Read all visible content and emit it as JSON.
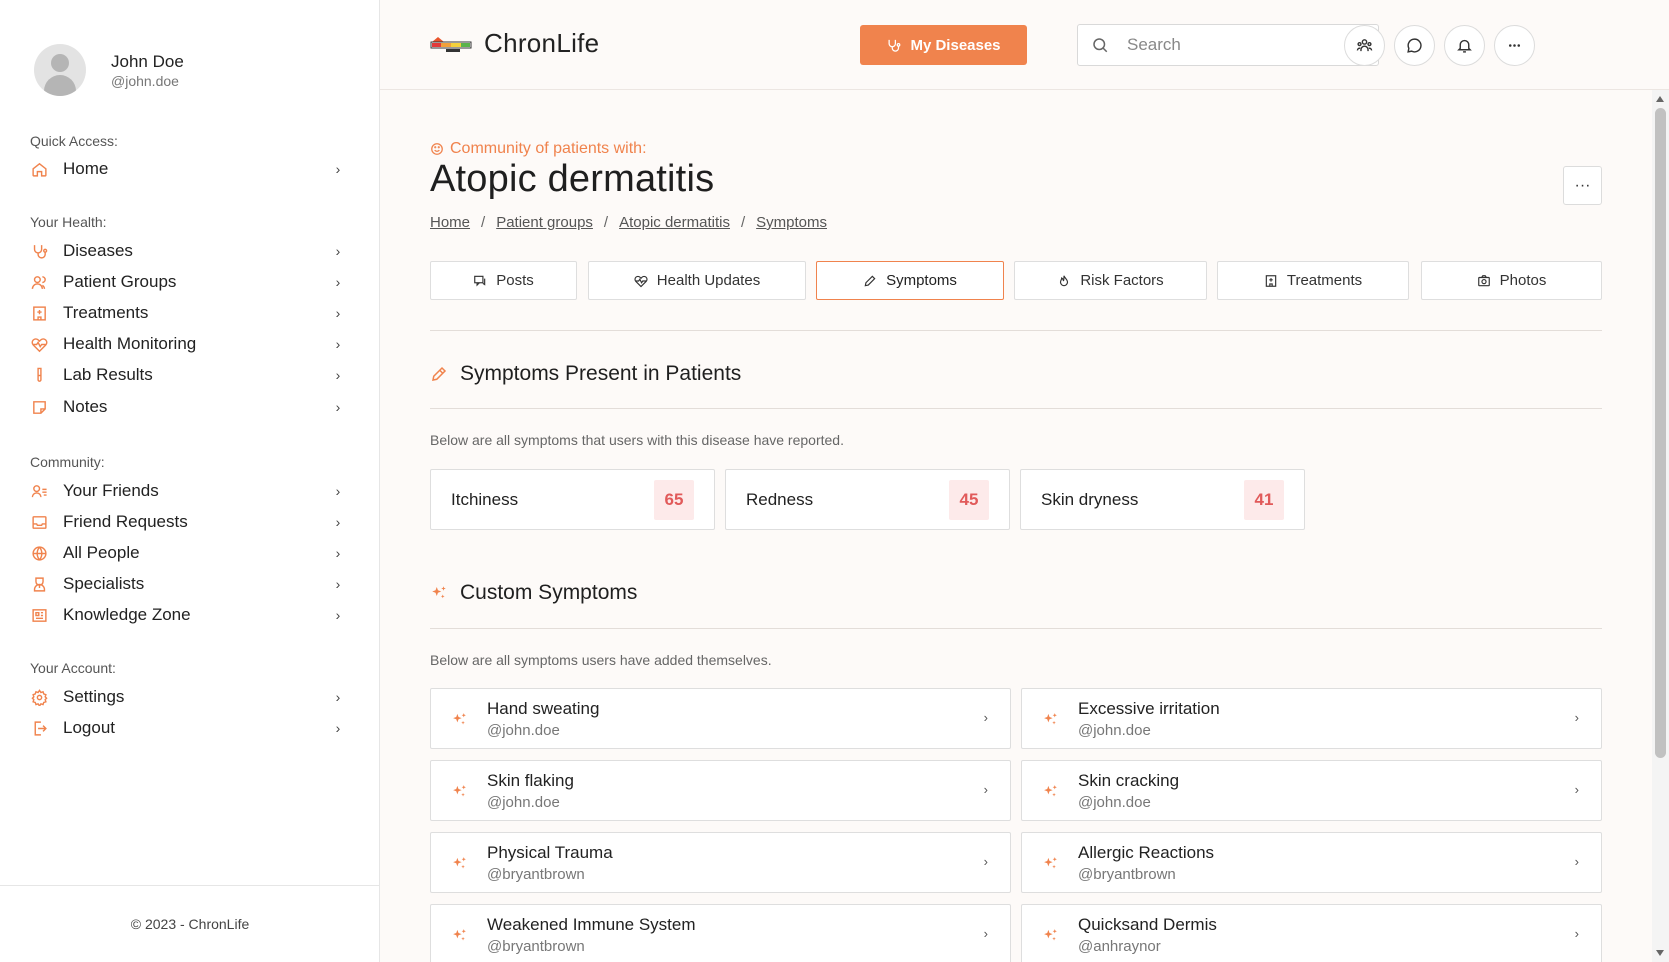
{
  "theme": {
    "accent": "#f0834d",
    "count_bg": "#fdeaea",
    "count_fg": "#e15a5a"
  },
  "profile": {
    "name": "John Doe",
    "handle": "@john.doe"
  },
  "sidebar": {
    "quick_access_label": "Quick Access:",
    "quick_access": [
      {
        "label": "Home",
        "icon": "home-icon"
      }
    ],
    "your_health_label": "Your Health:",
    "your_health": [
      {
        "label": "Diseases",
        "icon": "stethoscope-icon"
      },
      {
        "label": "Patient Groups",
        "icon": "users-icon"
      },
      {
        "label": "Treatments",
        "icon": "hospital-icon"
      },
      {
        "label": "Health Monitoring",
        "icon": "heart-pulse-icon"
      },
      {
        "label": "Lab Results",
        "icon": "test-tube-icon"
      },
      {
        "label": "Notes",
        "icon": "sticky-note-icon"
      }
    ],
    "community_label": "Community:",
    "community": [
      {
        "label": "Your Friends",
        "icon": "user-list-icon"
      },
      {
        "label": "Friend Requests",
        "icon": "inbox-icon"
      },
      {
        "label": "All People",
        "icon": "globe-icon"
      },
      {
        "label": "Specialists",
        "icon": "specialist-icon"
      },
      {
        "label": "Knowledge Zone",
        "icon": "newspaper-icon"
      }
    ],
    "account_label": "Your Account:",
    "account": [
      {
        "label": "Settings",
        "icon": "gear-icon"
      },
      {
        "label": "Logout",
        "icon": "logout-icon"
      }
    ],
    "footer": "© 2023 - ChronLife"
  },
  "header": {
    "brand": "ChronLife",
    "my_diseases_label": "My Diseases",
    "search_placeholder": "Search"
  },
  "page": {
    "community_label": "Community of patients with:",
    "title": "Atopic dermatitis",
    "breadcrumb": [
      "Home",
      "Patient groups",
      "Atopic dermatitis",
      "Symptoms"
    ],
    "more_label": "···",
    "tabs": [
      {
        "label": "Posts",
        "icon": "chat-icon",
        "active": false
      },
      {
        "label": "Health Updates",
        "icon": "heart-pulse-icon",
        "active": false
      },
      {
        "label": "Symptoms",
        "icon": "pencil-icon",
        "active": true
      },
      {
        "label": "Risk Factors",
        "icon": "flame-icon",
        "active": false
      },
      {
        "label": "Treatments",
        "icon": "hospital-icon",
        "active": false
      },
      {
        "label": "Photos",
        "icon": "camera-icon",
        "active": false
      }
    ]
  },
  "symptoms": {
    "title": "Symptoms Present in Patients",
    "description": "Below are all symptoms that users with this disease have reported.",
    "items": [
      {
        "name": "Itchiness",
        "count": "65"
      },
      {
        "name": "Redness",
        "count": "45"
      },
      {
        "name": "Skin dryness",
        "count": "41"
      }
    ]
  },
  "custom_symptoms": {
    "title": "Custom Symptoms",
    "description": "Below are all symptoms users have added themselves.",
    "items": [
      {
        "name": "Hand sweating",
        "user": "@john.doe"
      },
      {
        "name": "Excessive irritation",
        "user": "@john.doe"
      },
      {
        "name": "Skin flaking",
        "user": "@john.doe"
      },
      {
        "name": "Skin cracking",
        "user": "@john.doe"
      },
      {
        "name": "Physical Trauma",
        "user": "@bryantbrown"
      },
      {
        "name": "Allergic Reactions",
        "user": "@bryantbrown"
      },
      {
        "name": "Weakened Immune System",
        "user": "@bryantbrown"
      },
      {
        "name": "Quicksand Dermis",
        "user": "@anhraynor"
      }
    ]
  }
}
